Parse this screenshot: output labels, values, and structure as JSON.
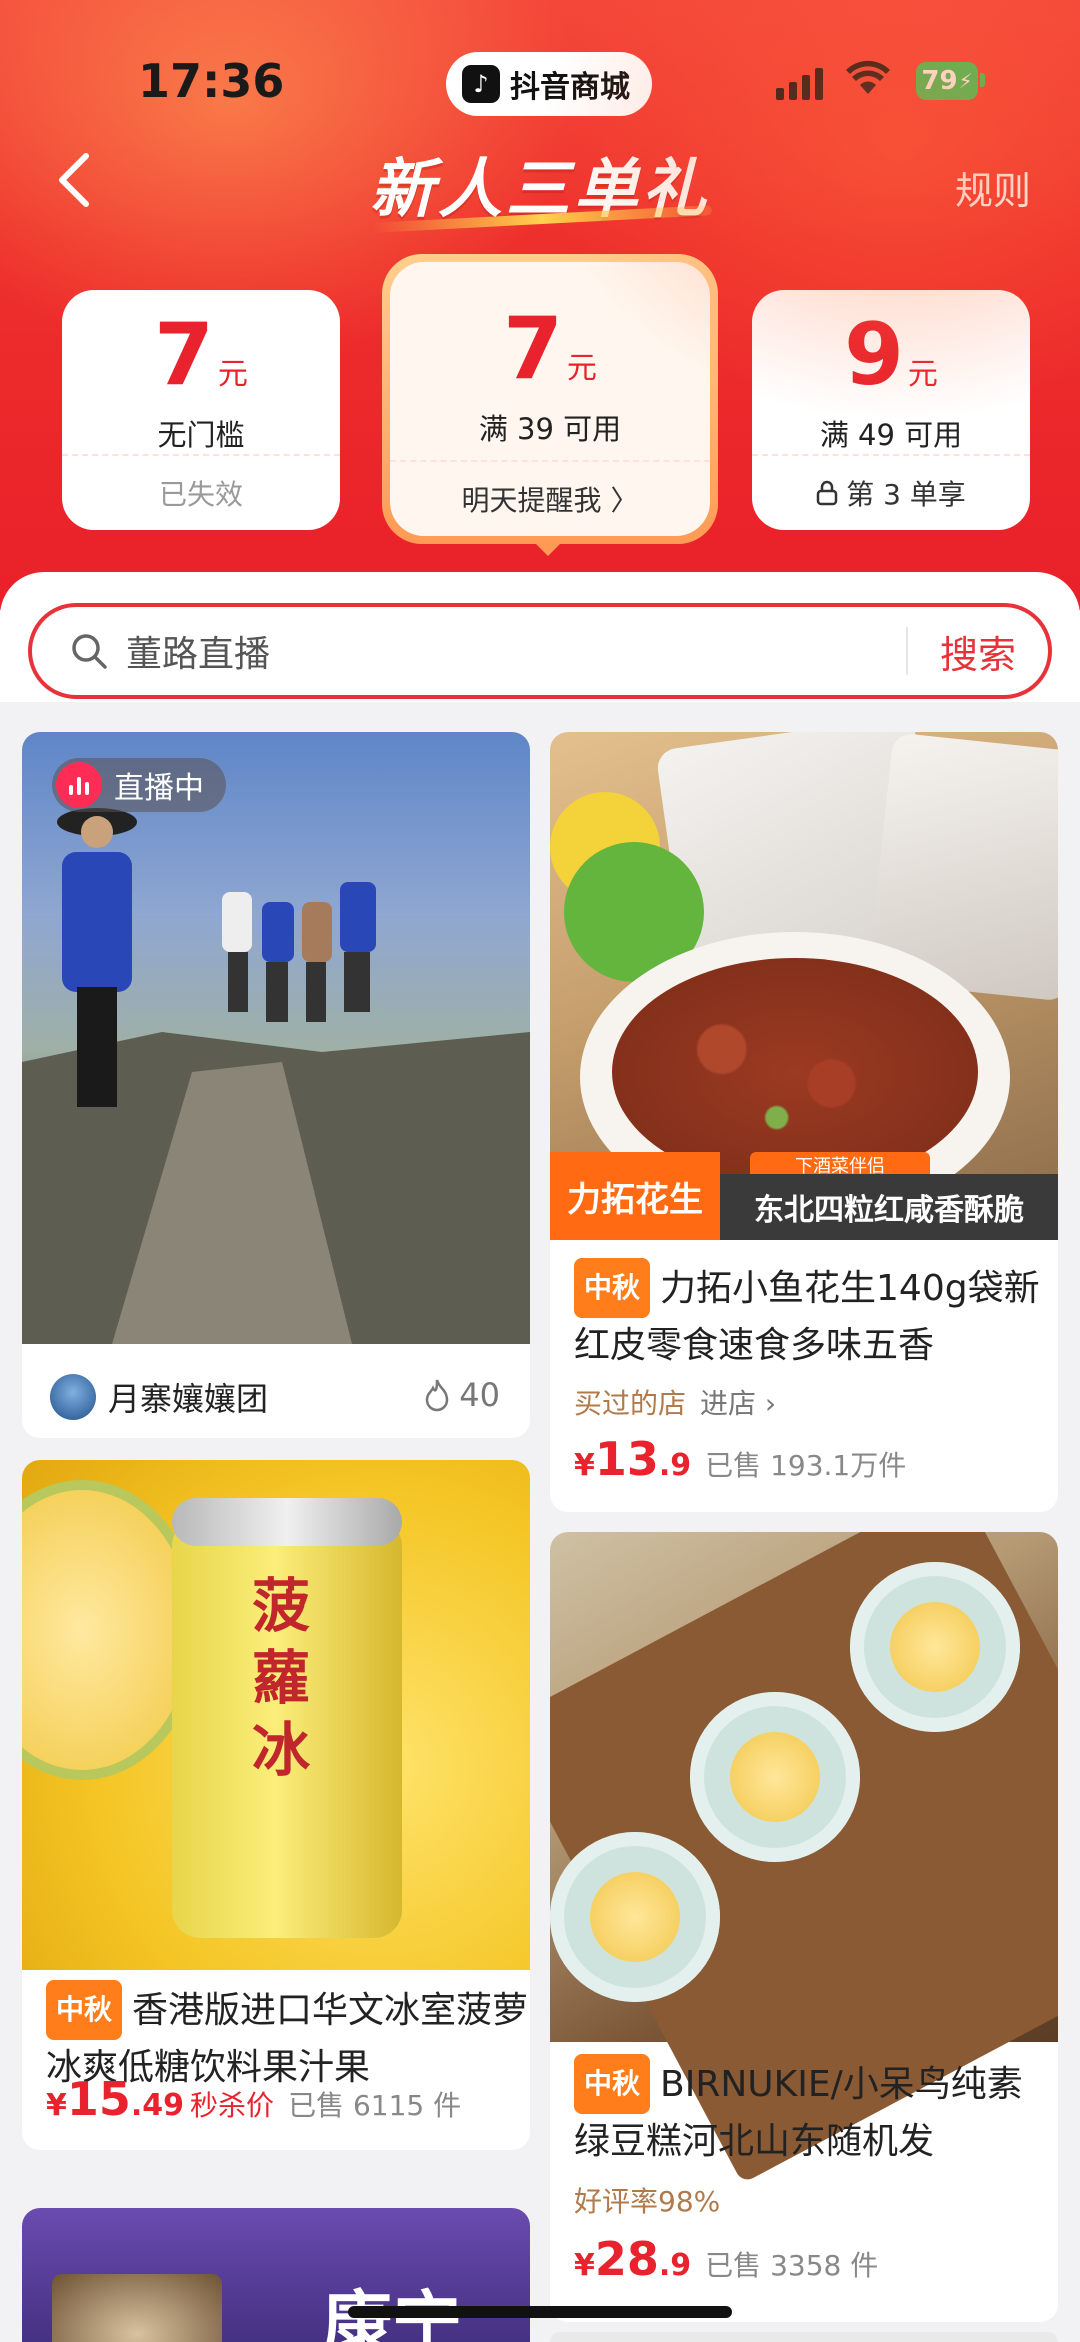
{
  "status_bar": {
    "time": "17:36",
    "app_pill": "抖音商城",
    "battery": "79"
  },
  "header": {
    "title": "新人三单礼",
    "rules": "规则"
  },
  "coupons": [
    {
      "amount": "7",
      "unit": "元",
      "condition": "无门槛",
      "footer": "已失效"
    },
    {
      "amount": "7",
      "unit": "元",
      "condition": "满 39 可用",
      "footer": "明天提醒我 〉"
    },
    {
      "amount": "9",
      "unit": "元",
      "condition": "满 49 可用",
      "footer": "第 3 单享"
    }
  ],
  "search": {
    "placeholder": "董路直播",
    "button": "搜索"
  },
  "feed": {
    "live_card": {
      "badge": "直播中",
      "author": "月寨孃孃团",
      "heat": "40"
    },
    "peanut_card": {
      "brand_label": "力拓花生",
      "sub_label": "下酒菜伴侣",
      "caption": "东北四粒红咸香酥脆",
      "tag": "中秋",
      "title": "力拓小鱼花生140g袋新红皮零食速食多味五香",
      "shop": "买过的店",
      "enter_shop": "进店 ›",
      "price_symbol": "¥",
      "price_int": "13",
      "price_dec": ".9",
      "sold": "已售 193.1万件"
    },
    "drink_card": {
      "can_text": "菠蘿冰",
      "tag": "中秋",
      "title": "香港版进口华文冰室菠萝冰爽低糖饮料果汁果",
      "price_symbol": "¥",
      "price_int": "15",
      "price_dec": ".49",
      "flash": "秒杀价",
      "sold": "已售 6115 件"
    },
    "cake_card": {
      "tag": "中秋",
      "title": "BIRNUKIE/小呆鸟纯素绿豆糕河北山东随机发",
      "rating": "好评率98%",
      "price_symbol": "¥",
      "price_int": "28",
      "price_dec": ".9",
      "sold": "已售 3358 件"
    },
    "partial_card": {
      "title_fragment": "康宁"
    }
  },
  "colors": {
    "brand_red": "#e8232d",
    "tag_orange": "#ff7d1a"
  }
}
